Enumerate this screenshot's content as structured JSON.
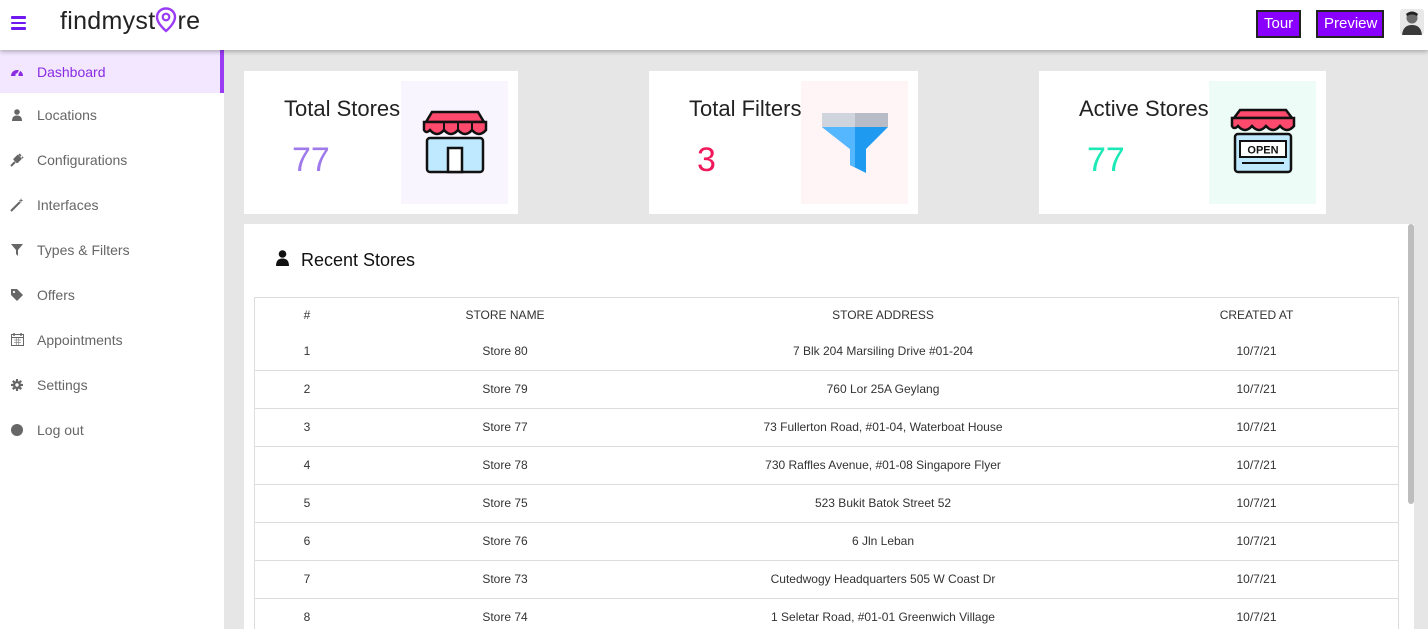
{
  "header": {
    "logo_text_a": "findmyst",
    "logo_text_b": "re",
    "tour_label": "Tour",
    "preview_label": "Preview",
    "accent": "#8a00ff"
  },
  "sidebar": {
    "items": [
      {
        "label": "Dashboard",
        "icon": "dashboard-icon",
        "active": true
      },
      {
        "label": "Locations",
        "icon": "user-icon"
      },
      {
        "label": "Configurations",
        "icon": "plug-icon"
      },
      {
        "label": "Interfaces",
        "icon": "magic-wand-icon"
      },
      {
        "label": "Types & Filters",
        "icon": "filter-icon"
      },
      {
        "label": "Offers",
        "icon": "tag-icon"
      },
      {
        "label": "Appointments",
        "icon": "calendar-icon"
      },
      {
        "label": "Settings",
        "icon": "gear-icon"
      },
      {
        "label": "Log out",
        "icon": "circle-icon"
      }
    ]
  },
  "stats": [
    {
      "title": "Total Stores",
      "value": "77",
      "color": "#9f7aea"
    },
    {
      "title": "Total Filters",
      "value": "3",
      "color": "#f0175a"
    },
    {
      "title": "Active Stores",
      "value": "77",
      "color": "#1de9b6"
    }
  ],
  "recent": {
    "title": "Recent Stores",
    "columns": [
      "#",
      "STORE NAME",
      "STORE ADDRESS",
      "CREATED AT"
    ],
    "rows": [
      [
        "1",
        "Store 80",
        "7 Blk 204 Marsiling Drive #01-204",
        "10/7/21"
      ],
      [
        "2",
        "Store 79",
        "760 Lor 25A Geylang",
        "10/7/21"
      ],
      [
        "3",
        "Store 77",
        "73 Fullerton Road, #01-04, Waterboat House",
        "10/7/21"
      ],
      [
        "4",
        "Store 78",
        "730 Raffles Avenue, #01-08 Singapore Flyer",
        "10/7/21"
      ],
      [
        "5",
        "Store 75",
        "523 Bukit Batok Street 52",
        "10/7/21"
      ],
      [
        "6",
        "Store 76",
        "6 Jln Leban",
        "10/7/21"
      ],
      [
        "7",
        "Store 73",
        "Cutedwogy Headquarters 505 W Coast Dr",
        "10/7/21"
      ],
      [
        "8",
        "Store 74",
        "1 Seletar Road, #01-01 Greenwich Village",
        "10/7/21"
      ]
    ]
  }
}
